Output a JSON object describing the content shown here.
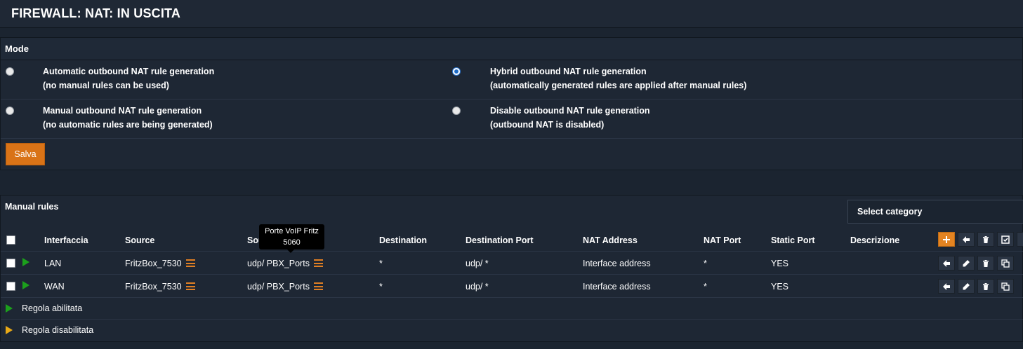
{
  "page": {
    "title": "FIREWALL: NAT: IN USCITA"
  },
  "mode": {
    "header": "Mode",
    "options": [
      {
        "line1": "Automatic outbound NAT rule generation",
        "line2": "(no manual rules can be used)",
        "checked": false
      },
      {
        "line1": "Hybrid outbound NAT rule generation",
        "line2": "(automatically generated rules are applied after manual rules)",
        "checked": true
      },
      {
        "line1": "Manual outbound NAT rule generation",
        "line2": "(no automatic rules are being generated)",
        "checked": false
      },
      {
        "line1": "Disable outbound NAT rule generation",
        "line2": "(outbound NAT is disabled)",
        "checked": false
      }
    ],
    "save_label": "Salva"
  },
  "rules": {
    "header": "Manual rules",
    "select_category": "Select category",
    "columns": [
      "Interfaccia",
      "Source",
      "Source Port",
      "Destination",
      "Destination Port",
      "NAT Address",
      "NAT Port",
      "Static Port",
      "Descrizione"
    ],
    "rows": [
      {
        "interface": "LAN",
        "source": "FritzBox_7530",
        "source_port": "udp/ PBX_Ports",
        "destination": "*",
        "destination_port": "udp/ *",
        "nat_address": "Interface address",
        "nat_port": "*",
        "static_port": "YES",
        "description": ""
      },
      {
        "interface": "WAN",
        "source": "FritzBox_7530",
        "source_port": "udp/ PBX_Ports",
        "destination": "*",
        "destination_port": "udp/ *",
        "nat_address": "Interface address",
        "nat_port": "*",
        "static_port": "YES",
        "description": ""
      }
    ],
    "legend": {
      "enabled": "Regola abilitata",
      "disabled": "Regola disabilitata"
    },
    "tooltip": {
      "title": "Porte VoIP Fritz",
      "value": "5060"
    }
  },
  "colors": {
    "accent": "#e48421",
    "enabled": "#1ca01c",
    "disabled": "#e8a917",
    "background": "#1b2430"
  }
}
